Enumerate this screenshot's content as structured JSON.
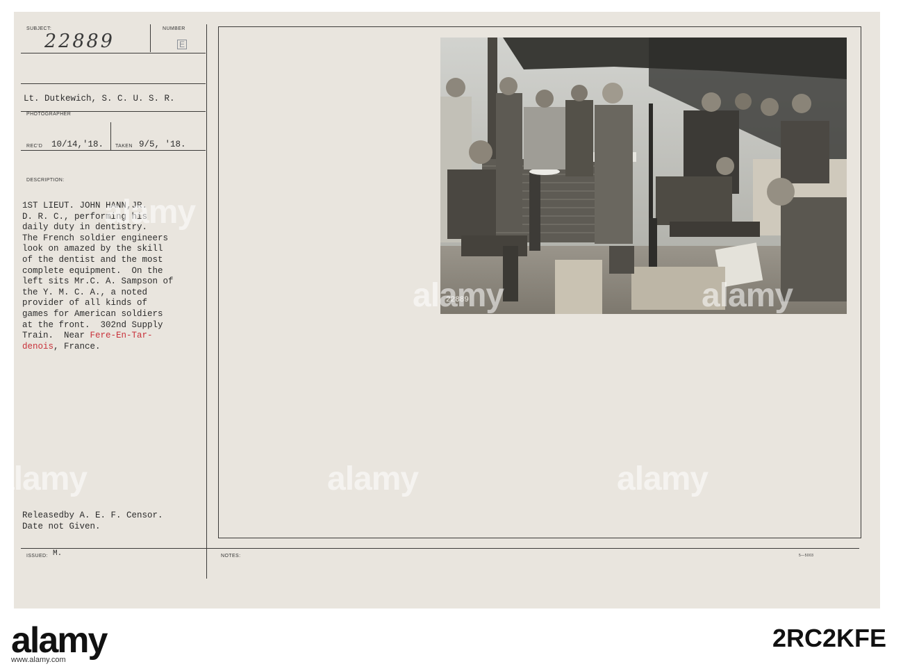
{
  "card": {
    "subject_label": "SUBJECT:",
    "number_label": "NUMBER",
    "subject_number": "22889",
    "number_letter": "E",
    "photographer_name": "Lt. Dutkewich, S. C. U. S. R.",
    "photographer_label": "PHOTOGRAPHER",
    "recd_label": "REC'D",
    "recd_date": "10/14,'18.",
    "taken_label": "TAKEN",
    "taken_date": "9/5, '18.",
    "description_label": "DESCRIPTION:",
    "description_lines": [
      "1ST LIEUT. JOHN HANN,JR.",
      "D. R. C., performing his",
      "daily duty in dentistry.",
      "The French soldier engineers",
      "look on amazed by the skill",
      "of the dentist and the most",
      "complete equipment.  On the",
      "left sits Mr.C. A. Sampson of",
      "the Y. M. C. A., a noted",
      "provider of all kinds of",
      "games for American soldiers",
      "at the front.  302nd Supply",
      "Train.  Near "
    ],
    "place_part1": "Fere-En-Tar-",
    "place_part2": "denois",
    "place_suffix": ", France.",
    "released_line1": "Releasedby A. E. F. Censor.",
    "released_line2": "Date not Given.",
    "issued_label": "ISSUED:",
    "issued_value": "M.",
    "notes_label": "NOTES:",
    "form_code": "5—5003",
    "photo_number": "22889"
  },
  "watermark": "alamy",
  "footer": {
    "logo": "alamy",
    "image_id": "2RC2KFE",
    "url": "www.alamy.com"
  },
  "colors": {
    "card": "#e9e5de",
    "place_name": "#c8313a"
  }
}
